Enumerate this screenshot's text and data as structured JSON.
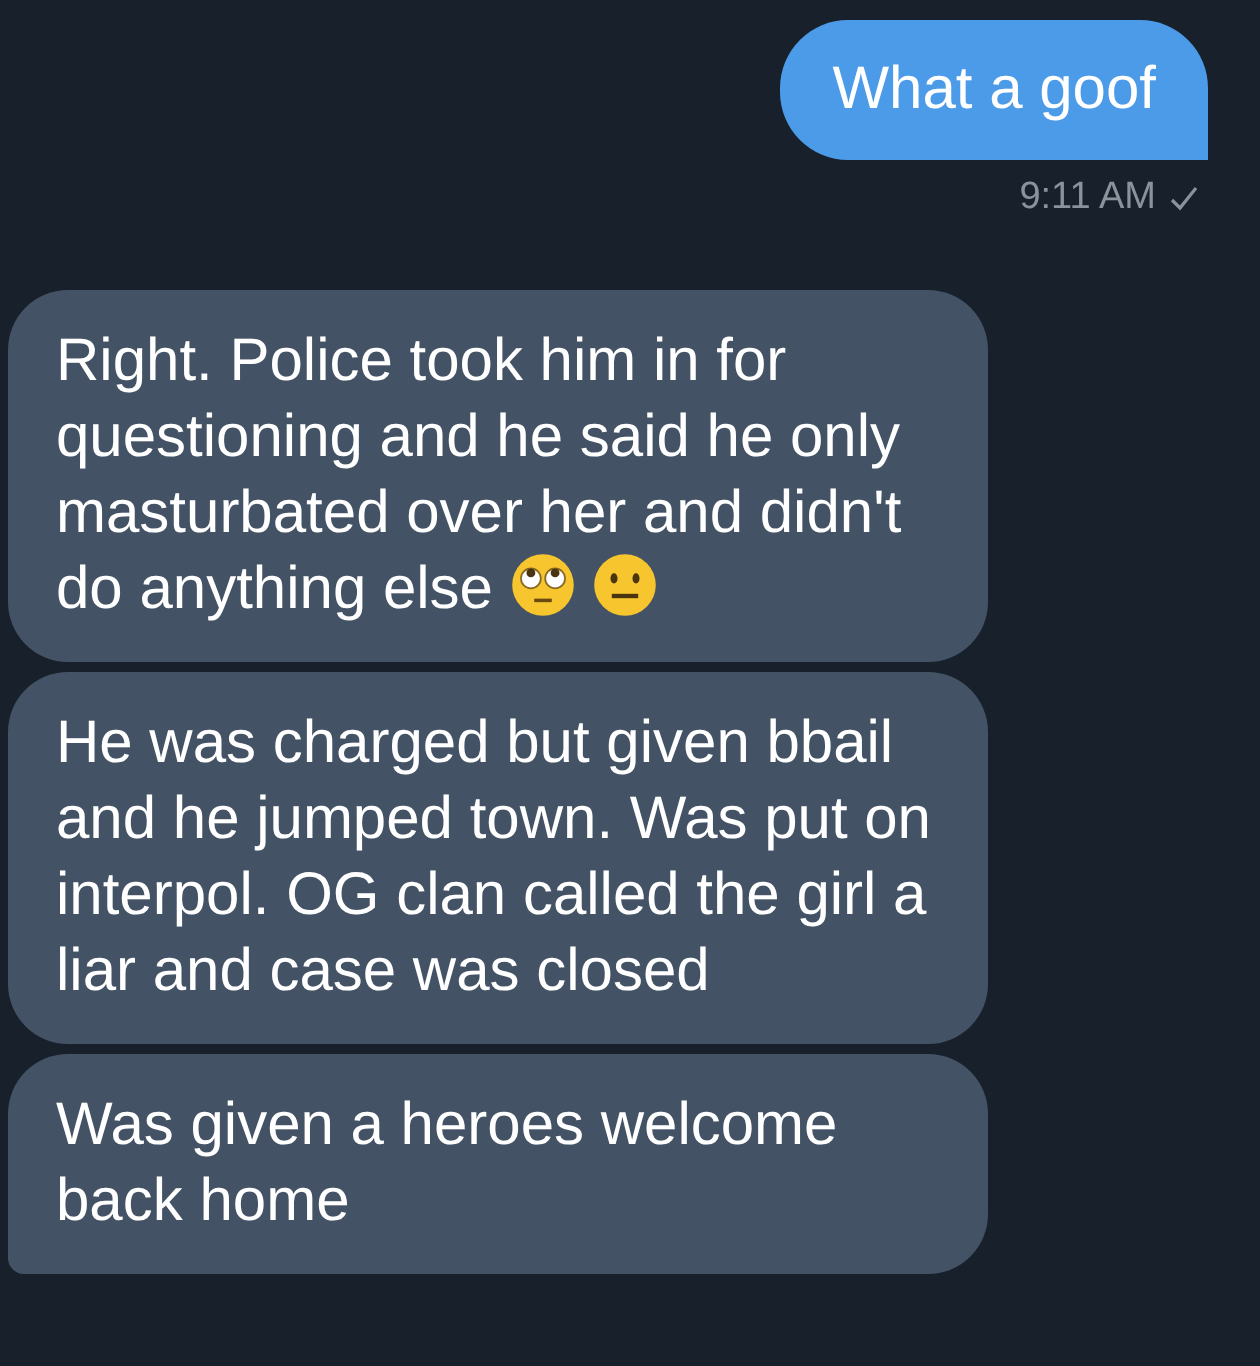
{
  "messages": [
    {
      "kind": "outgoing",
      "text": "What a goof",
      "time": "9:11 AM",
      "read": true
    },
    {
      "kind": "incoming",
      "text": "Right. Police took him in for questioning and he said he only masturbated over her and didn't do anything else",
      "emoji": [
        {
          "kind": "rolling-eyes"
        },
        {
          "kind": "neutral"
        }
      ]
    },
    {
      "kind": "incoming",
      "text": "He was charged but given bbail and he jumped town. Was put on interpol. OG clan called the girl a liar and case was closed"
    },
    {
      "kind": "incoming",
      "text": "Was given a heroes welcome back home"
    }
  ]
}
